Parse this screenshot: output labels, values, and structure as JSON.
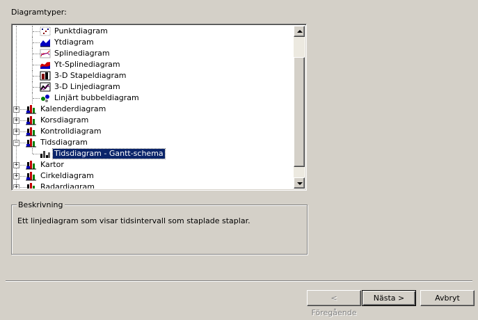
{
  "header": {
    "label": "Diagramtyper:"
  },
  "tree": {
    "items": [
      {
        "label": "Punktdiagram",
        "icon": "scatter-chart-icon",
        "level": 2
      },
      {
        "label": "Ytdiagram",
        "icon": "area-chart-icon",
        "level": 2
      },
      {
        "label": "Splinediagram",
        "icon": "spline-chart-icon",
        "level": 2
      },
      {
        "label": "Yt-Splinediagram",
        "icon": "area-spline-chart-icon",
        "level": 2
      },
      {
        "label": "3-D Stapeldiagram",
        "icon": "bar-3d-chart-icon",
        "level": 2
      },
      {
        "label": "3-D Linjediagram",
        "icon": "line-3d-chart-icon",
        "level": 2
      },
      {
        "label": "Linjärt bubbeldiagram",
        "icon": "bubble-chart-icon",
        "level": 2
      },
      {
        "label": "Kalenderdiagram",
        "icon": "folder-chart-icon",
        "level": 1,
        "expander": "+"
      },
      {
        "label": "Korsdiagram",
        "icon": "folder-chart-icon",
        "level": 1,
        "expander": "+"
      },
      {
        "label": "Kontrolldiagram",
        "icon": "folder-chart-icon",
        "level": 1,
        "expander": "+"
      },
      {
        "label": "Tidsdiagram",
        "icon": "folder-chart-icon",
        "level": 1,
        "expander": "−"
      },
      {
        "label": "Tidsdiagram - Gantt-schema",
        "icon": "gantt-chart-icon",
        "level": 2,
        "selected": true
      },
      {
        "label": "Kartor",
        "icon": "folder-chart-icon",
        "level": 1,
        "expander": "+"
      },
      {
        "label": "Cirkeldiagram",
        "icon": "folder-chart-icon",
        "level": 1,
        "expander": "+"
      },
      {
        "label": "Radardiagram",
        "icon": "folder-chart-icon",
        "level": 1,
        "expander": "+"
      }
    ]
  },
  "description": {
    "legend": "Beskrivning",
    "text": "Ett linjediagram som visar tidsintervall som staplade staplar."
  },
  "buttons": {
    "back": "< Föregående",
    "next": "Nästa >",
    "cancel": "Avbryt"
  },
  "colors": {
    "selection": "#0a246a",
    "face": "#d4d0c8"
  }
}
